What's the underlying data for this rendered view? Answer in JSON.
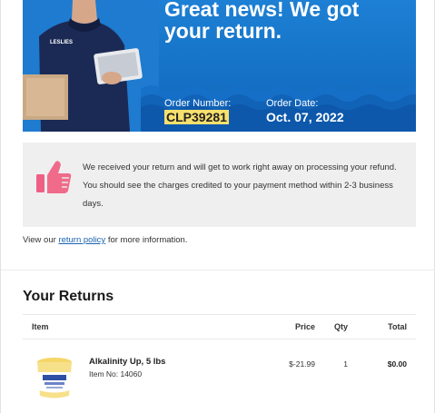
{
  "hero": {
    "title": "Great news! We got your return.",
    "order_number_label": "Order Number:",
    "order_number": "CLP39281",
    "order_date_label": "Order Date:",
    "order_date": "Oct. 07, 2022",
    "shirt_logo_text": "LESLIES"
  },
  "notice": {
    "icon": "thumbs-up-icon",
    "message": "We received your return and will get to work right away on processing your refund. You should see the charges credited to your payment method within 2-3 business days."
  },
  "policy": {
    "prefix": "View our",
    "link": "return policy",
    "suffix": "for more information."
  },
  "returns": {
    "title": "Your Returns",
    "columns": {
      "item": "Item",
      "price": "Price",
      "qty": "Qty",
      "total": "Total"
    },
    "items": [
      {
        "name": "Alkalinity Up, 5 lbs",
        "item_no": "Item No: 14060",
        "price": "$-21.99",
        "qty": "1",
        "total": "$0.00"
      }
    ]
  },
  "colors": {
    "hero_blue": "#1572c6",
    "highlight": "#f7e06e",
    "thumb_pink": "#f06a8a",
    "link": "#1a63b0"
  }
}
